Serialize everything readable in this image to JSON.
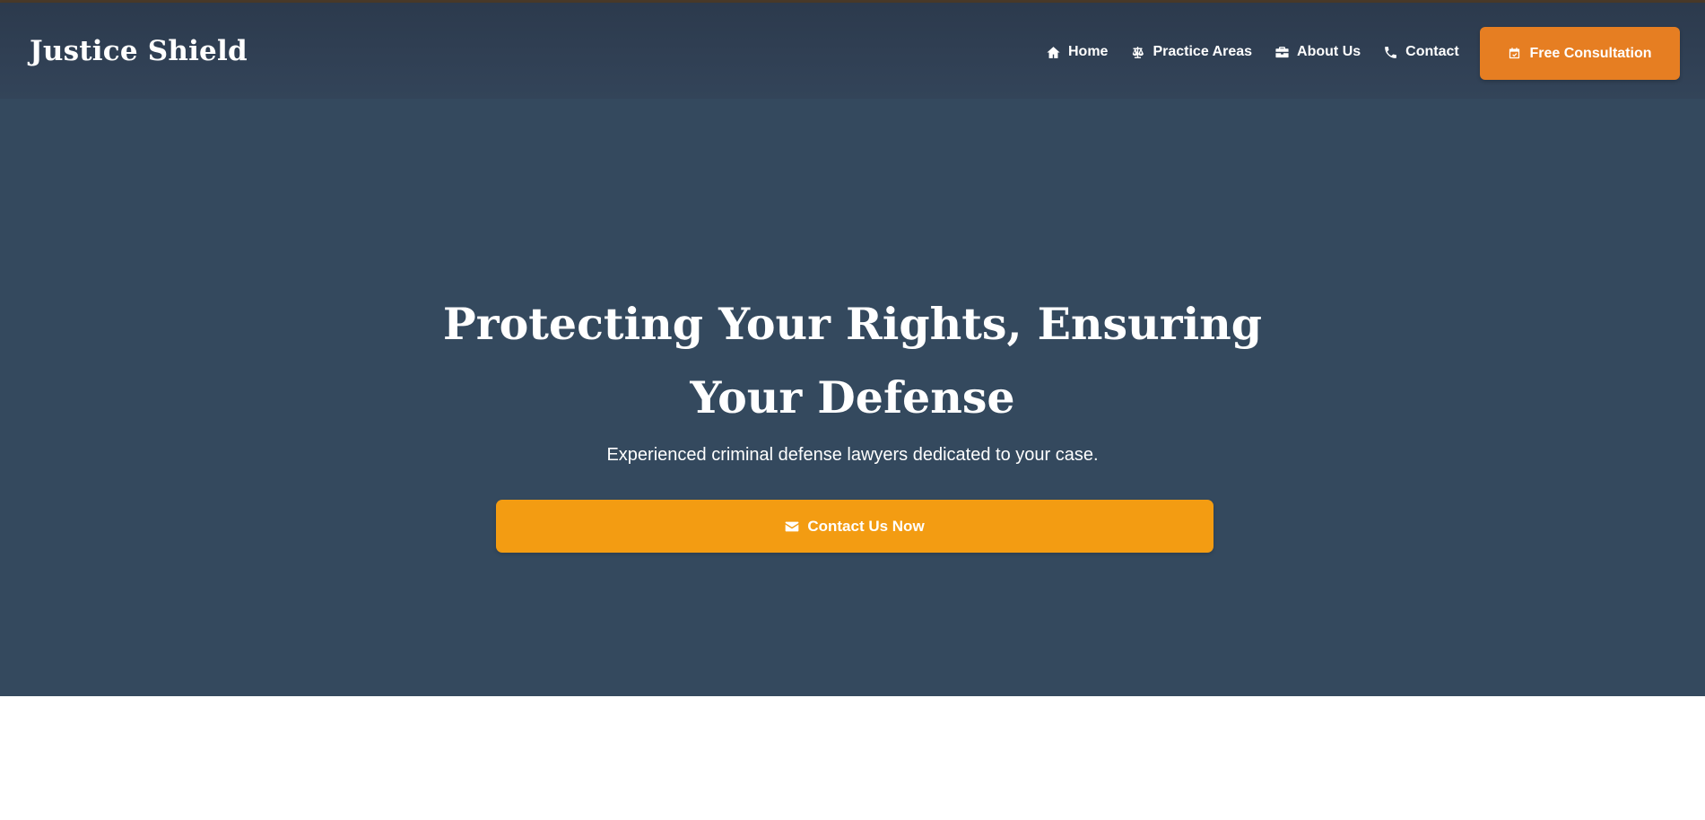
{
  "header": {
    "brand": "Justice Shield",
    "nav": [
      {
        "label": "Home",
        "icon": "home-icon"
      },
      {
        "label": "Practice Areas",
        "icon": "scale-icon"
      },
      {
        "label": "About Us",
        "icon": "briefcase-icon"
      },
      {
        "label": "Contact",
        "icon": "phone-icon"
      }
    ],
    "cta": {
      "label": "Free Consultation",
      "icon": "calendar-check-icon"
    }
  },
  "hero": {
    "title": "Protecting Your Rights, Ensuring Your Defense",
    "subtitle": "Experienced criminal defense lawyers dedicated to your case.",
    "button": {
      "label": "Contact Us Now",
      "icon": "envelope-icon"
    }
  },
  "colors": {
    "header_bg": "#2c3a4d",
    "hero_bg": "#34495e",
    "consult_button": "#e67e22",
    "cta_button": "#f39c12",
    "text": "#ffffff"
  }
}
